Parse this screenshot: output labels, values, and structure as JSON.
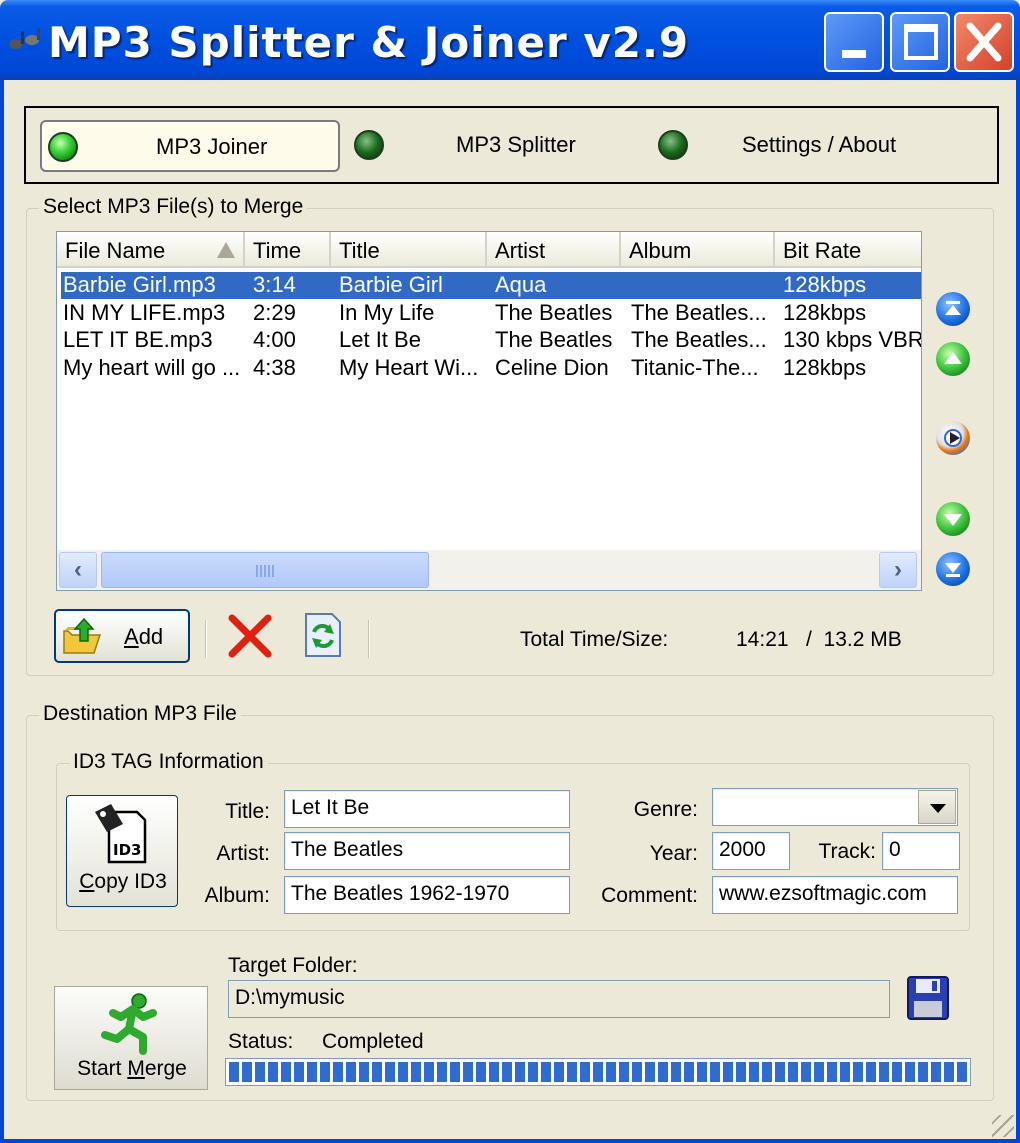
{
  "window": {
    "title": "MP3 Splitter & Joiner v2.9",
    "controls": {
      "minimize": "minimize",
      "maximize": "maximize",
      "close": "close"
    }
  },
  "tabs": [
    {
      "label": "MP3 Joiner",
      "active": true
    },
    {
      "label": "MP3 Splitter",
      "active": false
    },
    {
      "label": "Settings / About",
      "active": false
    }
  ],
  "select_group": {
    "legend": "Select MP3 File(s) to Merge",
    "columns": [
      "File Name",
      "Time",
      "Title",
      "Artist",
      "Album",
      "Bit Rate"
    ],
    "rows": [
      {
        "file": "Barbie Girl.mp3",
        "time": "3:14",
        "title": "Barbie Girl",
        "artist": "Aqua",
        "album": "",
        "bitrate": "128kbps",
        "selected": true
      },
      {
        "file": "IN MY LIFE.mp3",
        "time": "2:29",
        "title": "In My Life",
        "artist": "The Beatles",
        "album": "The Beatles...",
        "bitrate": "128kbps",
        "selected": false
      },
      {
        "file": "LET IT BE.mp3",
        "time": "4:00",
        "title": "Let It Be",
        "artist": "The Beatles",
        "album": "The Beatles...",
        "bitrate": "130 kbps VBR",
        "selected": false
      },
      {
        "file": "My heart will go ...",
        "time": "4:38",
        "title": "My Heart Wi...",
        "artist": "Celine Dion",
        "album": "Titanic-The...",
        "bitrate": "128kbps",
        "selected": false
      }
    ],
    "add_button": {
      "prefix": "",
      "accel": "A",
      "rest": "dd"
    },
    "totals_label": "Total Time/Size:",
    "totals_value": "14:21   /  13.2 MB"
  },
  "destination_group": {
    "legend": "Destination MP3 File",
    "id3_group": {
      "legend": "ID3 TAG Information",
      "copy_button": {
        "accel": "C",
        "rest": "opy ID3",
        "badge": "ID3"
      },
      "title_label": "Title:",
      "title_value": "Let It Be",
      "artist_label": "Artist:",
      "artist_value": "The Beatles",
      "album_label": "Album:",
      "album_value": "The Beatles 1962-1970",
      "genre_label": "Genre:",
      "genre_value": "",
      "year_label": "Year:",
      "year_value": "2000",
      "track_label": "Track:",
      "track_value": "0",
      "comment_label": "Comment:",
      "comment_value": "www.ezsoftmagic.com"
    },
    "target_folder_label": "Target Folder:",
    "target_folder_value": "D:\\mymusic",
    "status_label": "Status:",
    "status_value": "Completed",
    "start_button": {
      "prefix": "Start ",
      "accel": "M",
      "rest": "erge"
    },
    "progress_fraction": 1.0
  },
  "colors": {
    "titlebar": "#0050E0",
    "selection": "#316AC5",
    "progress": "#2F6CD0",
    "led_on": "#3FD23F",
    "delete_red": "#E02010"
  },
  "icons": {
    "app": "app-note-icon",
    "add": "open-folder-arrow-icon",
    "delete": "red-x-icon",
    "refresh": "refresh-document-icon",
    "move_top": "move-top-icon",
    "move_up": "move-up-icon",
    "play": "play-icon",
    "move_down": "move-down-icon",
    "move_bottom": "move-bottom-icon",
    "save": "floppy-disk-icon",
    "copy_id3": "id3-tag-icon",
    "start_merge": "running-man-icon"
  }
}
